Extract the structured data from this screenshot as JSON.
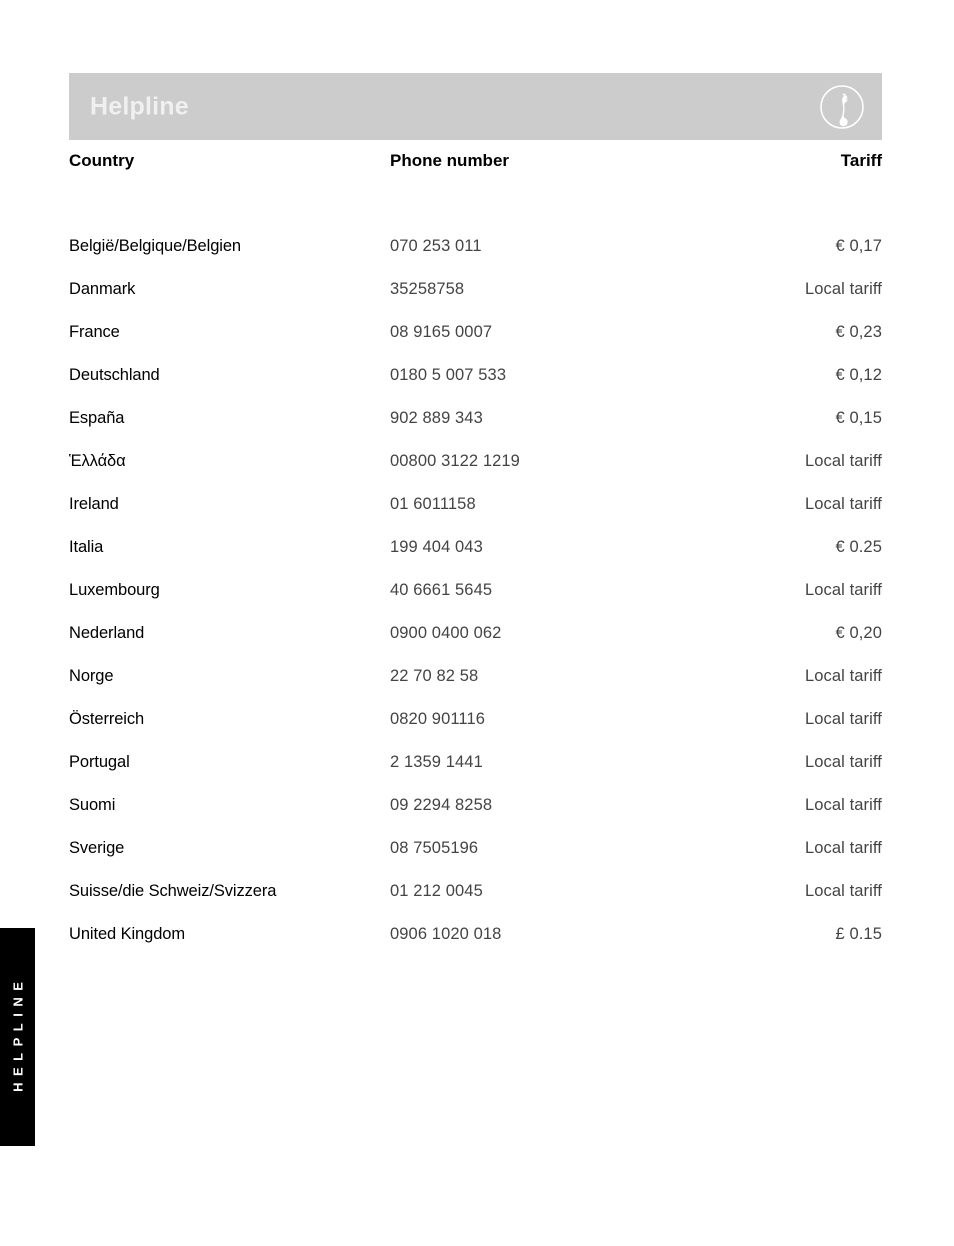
{
  "side_tab": {
    "label": "HELPLINE"
  },
  "banner": {
    "title": "Helpline",
    "icon": "telephone-handset-icon",
    "background_color": "#cccccc",
    "title_color": "#f0f0f0"
  },
  "table": {
    "columns": {
      "country": "Country",
      "phone": "Phone number",
      "tariff": "Tariff"
    },
    "rows": [
      {
        "country": "België/Belgique/Belgien",
        "phone": "070 253 011",
        "tariff": "€ 0,17"
      },
      {
        "country": "Danmark",
        "phone": "35258758",
        "tariff": "Local tariff"
      },
      {
        "country": "France",
        "phone": "08 9165 0007",
        "tariff": "€ 0,23"
      },
      {
        "country": "Deutschland",
        "phone": "0180 5 007 533",
        "tariff": "€ 0,12"
      },
      {
        "country": "España",
        "phone": "902 889 343",
        "tariff": "€ 0,15"
      },
      {
        "country": "Ἑλλάδα",
        "phone": "00800 3122 1219",
        "tariff": "Local tariff"
      },
      {
        "country": "Ireland",
        "phone": "01 6011158",
        "tariff": "Local tariff"
      },
      {
        "country": "Italia",
        "phone": "199 404 043",
        "tariff": "€ 0.25"
      },
      {
        "country": "Luxembourg",
        "phone": "40 6661 5645",
        "tariff": "Local tariff"
      },
      {
        "country": "Nederland",
        "phone": "0900 0400 062",
        "tariff": "€ 0,20"
      },
      {
        "country": "Norge",
        "phone": "22 70 82 58",
        "tariff": "Local tariff"
      },
      {
        "country": "Österreich",
        "phone": "0820 901116",
        "tariff": "Local tariff"
      },
      {
        "country": "Portugal",
        "phone": "2 1359 1441",
        "tariff": "Local tariff"
      },
      {
        "country": "Suomi",
        "phone": "09 2294 8258",
        "tariff": "Local tariff"
      },
      {
        "country": "Sverige",
        "phone": "08 7505196",
        "tariff": "Local tariff"
      },
      {
        "country": "Suisse/die Schweiz/Svizzera",
        "phone": "01 212 0045",
        "tariff": "Local tariff"
      },
      {
        "country": "United Kingdom",
        "phone": "0906 1020 018",
        "tariff": "£ 0.15"
      }
    ]
  }
}
